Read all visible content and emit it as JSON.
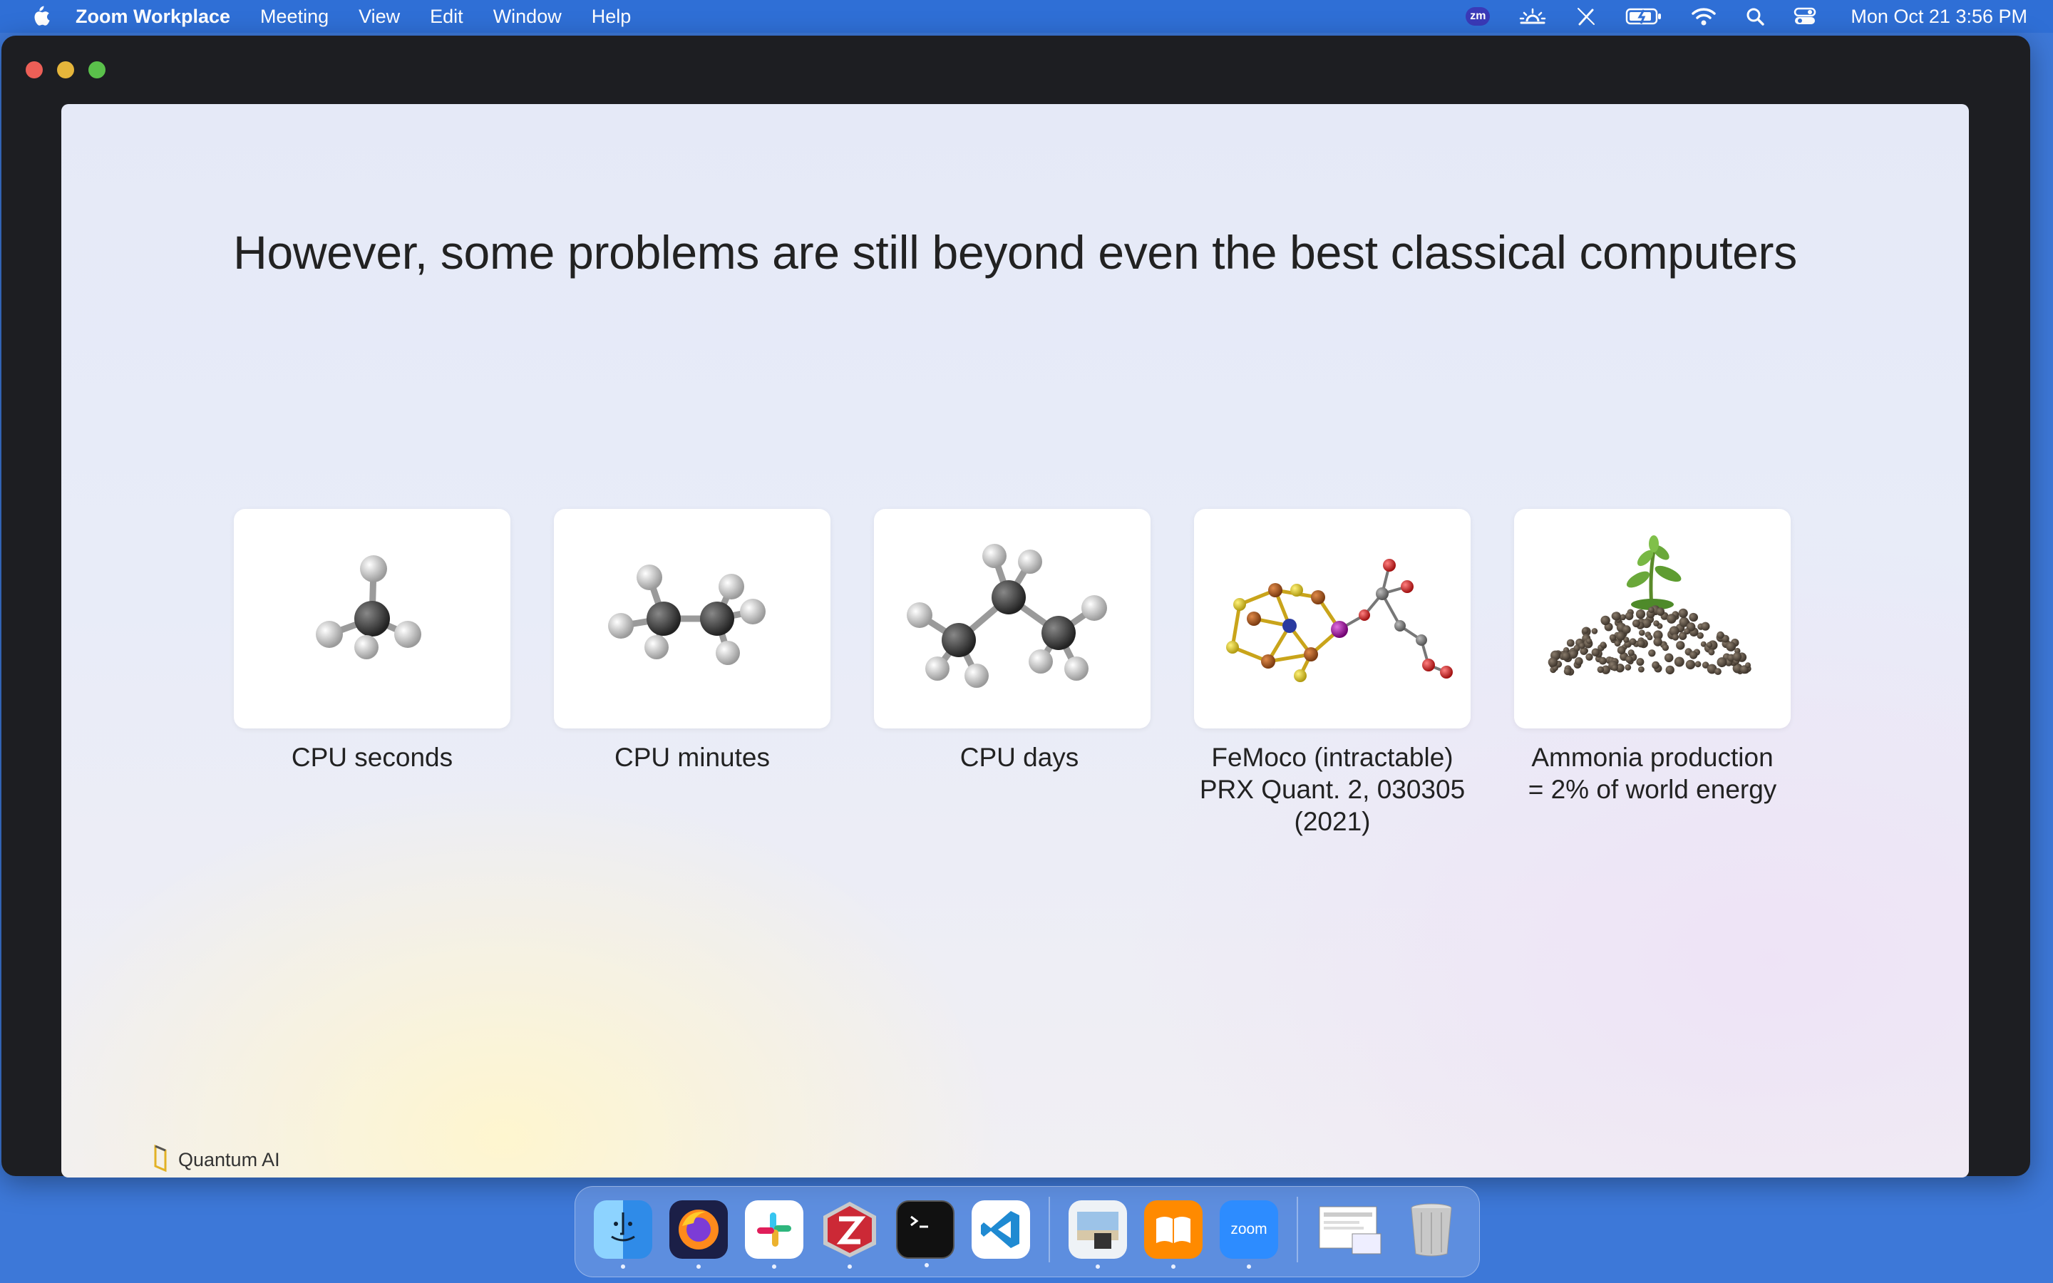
{
  "menubar": {
    "app_name": "Zoom Workplace",
    "menus": [
      "Meeting",
      "View",
      "Edit",
      "Window",
      "Help"
    ],
    "zoom_badge": "zm",
    "clock": "Mon Oct 21  3:56 PM"
  },
  "slide": {
    "title": "However, some problems are still beyond even the best classical computers",
    "cards": [
      {
        "caption_lines": [
          "CPU seconds"
        ],
        "image": "methane-molecule"
      },
      {
        "caption_lines": [
          "CPU minutes"
        ],
        "image": "ethane-molecule"
      },
      {
        "caption_lines": [
          "CPU days"
        ],
        "image": "propane-molecule"
      },
      {
        "caption_lines": [
          "FeMoco (intractable)",
          "PRX Quant. 2, 030305",
          "(2021)"
        ],
        "image": "femoco-cluster"
      },
      {
        "caption_lines": [
          "Ammonia production",
          "= 2% of world energy"
        ],
        "image": "fertilizer-pile-with-sprout"
      }
    ],
    "brand": "Quantum AI"
  },
  "dock": {
    "items": [
      "Finder",
      "Firefox",
      "Slack",
      "Zotero",
      "Terminal",
      "Visual Studio Code",
      "Preview",
      "Books",
      "Zoom",
      "Screenshot",
      "Trash"
    ],
    "zoom_label": "zoom"
  },
  "colors": {
    "menubar": "#2f6fd6",
    "desktop": "#3d78d8",
    "window_bg": "#1d1e22",
    "traffic_close": "#ec5f57",
    "traffic_min": "#e5b53b",
    "traffic_max": "#5ac14b"
  }
}
